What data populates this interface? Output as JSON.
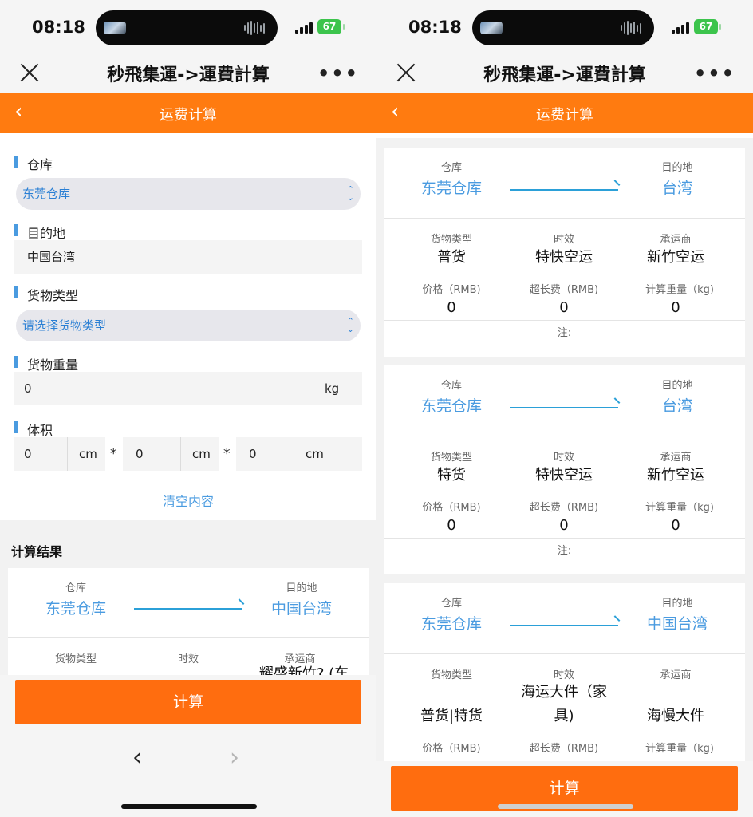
{
  "status": {
    "time": "08:18",
    "battery": "67"
  },
  "titlebar": {
    "title": "秒飛集運->運費計算",
    "more": "•••"
  },
  "header": {
    "title": "运费计算",
    "back": "‹"
  },
  "form": {
    "warehouse_label": "仓库",
    "warehouse_value": "东莞仓库",
    "destination_label": "目的地",
    "destination_value": "中国台湾",
    "cargo_type_label": "货物类型",
    "cargo_type_placeholder": "请选择货物类型",
    "weight_label": "货物重量",
    "weight_value": "0",
    "weight_unit": "kg",
    "volume_label": "体积",
    "volume": [
      {
        "value": "0",
        "unit": "cm"
      },
      {
        "value": "0",
        "unit": "cm"
      },
      {
        "value": "0",
        "unit": "cm"
      }
    ],
    "times": "*",
    "clear_label": "清空内容"
  },
  "result_heading": "计算结果",
  "captions": {
    "warehouse": "仓库",
    "destination": "目的地",
    "cargo_type": "货物类型",
    "timeliness": "时效",
    "carrier": "承运商",
    "price": "价格（RMB)",
    "overlength": "超长费（RMB)",
    "weight": "计算重量（kg)",
    "note": "注:"
  },
  "left_card": {
    "from": "东莞仓库",
    "to": "中国台湾",
    "carrier_partial": "耀盛新竹? (车"
  },
  "results": [
    {
      "from": "东莞仓库",
      "to": "台湾",
      "cargo_type": "普货",
      "timeliness": "特快空运",
      "carrier": "新竹空运",
      "price": "0",
      "overlength": "0",
      "weight": "0"
    },
    {
      "from": "东莞仓库",
      "to": "台湾",
      "cargo_type": "特货",
      "timeliness": "特快空运",
      "carrier": "新竹空运",
      "price": "0",
      "overlength": "0",
      "weight": "0"
    },
    {
      "from": "东莞仓库",
      "to": "中国台湾",
      "cargo_type": "普货|特货",
      "timeliness_line1": "海运大件（家",
      "timeliness_line2": "具)",
      "carrier": "海慢大件"
    }
  ],
  "calc_button": "计算",
  "nav": {
    "prev": "‹",
    "next": "›"
  },
  "colors": {
    "accent_orange": "#ff7b10",
    "link_blue": "#4a9be0"
  },
  "icons": [
    "close-icon",
    "more-icon",
    "back-icon",
    "select-arrows-icon",
    "route-arrow-icon",
    "prev-icon",
    "next-icon"
  ]
}
